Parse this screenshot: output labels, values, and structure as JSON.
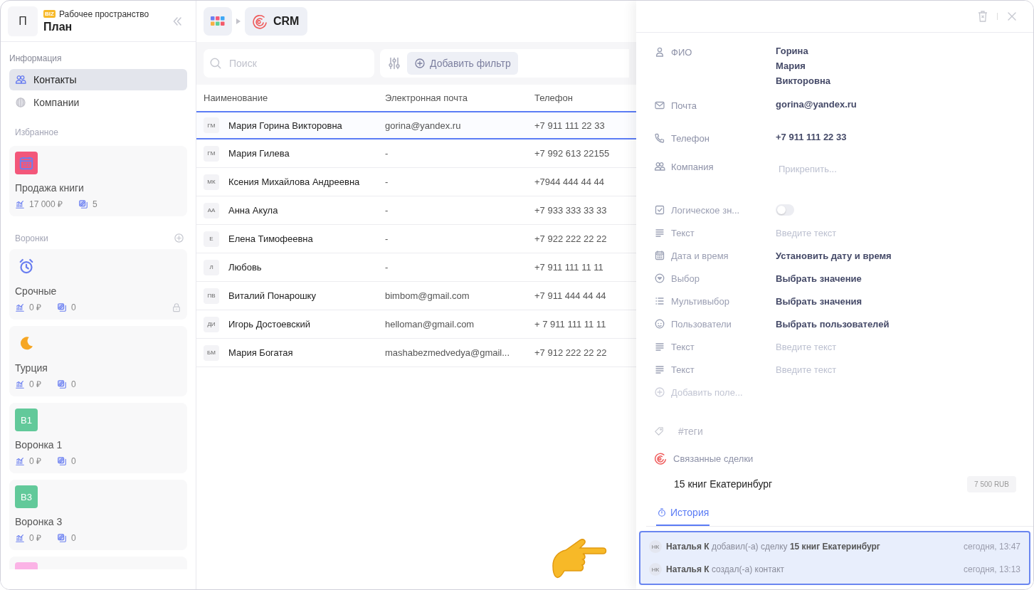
{
  "workspace": {
    "avatar": "П",
    "badge": "BIZ",
    "caption": "Рабочее пространство",
    "name": "План"
  },
  "sidebar": {
    "info_title": "Информация",
    "nav": [
      {
        "label": "Контакты",
        "kind": "contacts",
        "selected": true
      },
      {
        "label": "Компании",
        "kind": "companies",
        "selected": false
      }
    ],
    "favorites_title": "Избранное",
    "favorites": [
      {
        "kind": "calendar",
        "name": "Продажа книги",
        "amount": "17 000 ₽",
        "count": "5",
        "locked": false
      }
    ],
    "funnels_title": "Воронки",
    "funnels": [
      {
        "kind": "alarm",
        "name": "Срочные",
        "amount": "0 ₽",
        "count": "0",
        "locked": true
      },
      {
        "kind": "moon",
        "name": "Турция",
        "amount": "0 ₽",
        "count": "0",
        "locked": false
      },
      {
        "kind": "badge",
        "badge": "B1",
        "color": "#62c99a",
        "name": "Воронка 1",
        "amount": "0 ₽",
        "count": "0",
        "locked": false
      },
      {
        "kind": "badge",
        "badge": "B3",
        "color": "#62c99a",
        "name": "Воронка 3",
        "amount": "0 ₽",
        "count": "0",
        "locked": false
      },
      {
        "kind": "badge",
        "color": "#fbb3e6"
      }
    ]
  },
  "breadcrumb": {
    "app": "CRM"
  },
  "search": {
    "placeholder": "Поиск"
  },
  "add_filter": "Добавить фильтр",
  "table": {
    "columns": [
      "Наименование",
      "Электронная почта",
      "Телефон"
    ],
    "rows": [
      {
        "initials": "ГМ",
        "name": "Мария Горина Викторовна",
        "email": "gorina@yandex.ru",
        "phone": "+7 911 111 22 33",
        "selected": true
      },
      {
        "initials": "ГМ",
        "name": "Мария Гилева",
        "email": "-",
        "phone": "+7 992 613 22155",
        "selected": false
      },
      {
        "initials": "МК",
        "name": "Ксения Михайлова Андреевна",
        "email": "-",
        "phone": "+7944 444 44 44",
        "selected": false
      },
      {
        "initials": "АА",
        "name": "Анна Акула",
        "email": "-",
        "phone": "+7 933 333 33 33",
        "selected": false
      },
      {
        "initials": "Е",
        "name": "Елена Тимофеевна",
        "email": "-",
        "phone": "+7 922 222 22 22",
        "selected": false
      },
      {
        "initials": "Л",
        "name": "Любовь",
        "email": "-",
        "phone": "+7 911 111 11 11",
        "selected": false
      },
      {
        "initials": "ПВ",
        "name": "Виталий Понарошку",
        "email": "bimbom@gmail.com",
        "phone": "+7 911 444 44 44",
        "selected": false
      },
      {
        "initials": "ДИ",
        "name": "Игорь Достоевский",
        "email": "helloman@gmail.com",
        "phone": "+ 7 911 111 11 11",
        "selected": false
      },
      {
        "initials": "БМ",
        "name": "Мария Богатая",
        "email": "mashabezmedvedya@gmail...",
        "phone": "+7 912 222 22 22",
        "selected": false
      }
    ]
  },
  "panel": {
    "fields": [
      {
        "kind": "name",
        "label": "ФИО",
        "lines": [
          "Горина",
          "Мария",
          "Викторовна"
        ]
      },
      {
        "kind": "email",
        "label": "Почта",
        "value": "gorina@yandex.ru"
      },
      {
        "kind": "phone",
        "label": "Телефон",
        "value": "+7 911 111 22 33"
      },
      {
        "kind": "company",
        "label": "Компания",
        "placeholder": "Прикрепить..."
      }
    ],
    "custom_fields": [
      {
        "kind": "boolean",
        "label": "Логическое зн...",
        "on": false
      },
      {
        "kind": "text",
        "label": "Текст",
        "placeholder": "Введите текст"
      },
      {
        "kind": "datetime",
        "label": "Дата и время",
        "value": "Установить дату и время"
      },
      {
        "kind": "select",
        "label": "Выбор",
        "value": "Выбрать значение"
      },
      {
        "kind": "multiselect",
        "label": "Мультивыбор",
        "value": "Выбрать значения"
      },
      {
        "kind": "users",
        "label": "Пользователи",
        "value": "Выбрать пользователей"
      },
      {
        "kind": "text",
        "label": "Текст",
        "placeholder": "Введите текст"
      },
      {
        "kind": "text",
        "label": "Текст",
        "placeholder": "Введите текст"
      }
    ],
    "add_field": "Добавить поле...",
    "tags": {
      "placeholder": "#теги"
    },
    "deals_title": "Связанные сделки",
    "deals": [
      {
        "name": "15 книг Екатеринбург",
        "amount": "7 500 RUB"
      }
    ],
    "tabs": [
      {
        "label": "История",
        "selected": true
      }
    ],
    "history": [
      {
        "initials": "НК",
        "author": "Наталья К",
        "action": "добавил(-а) сделку",
        "object": "15 книг Екатеринбург",
        "time": "сегодня, 13:47"
      },
      {
        "initials": "НК",
        "author": "Наталья К",
        "action": "создал(-а) контакт",
        "time": "сегодня, 13:13"
      }
    ]
  }
}
